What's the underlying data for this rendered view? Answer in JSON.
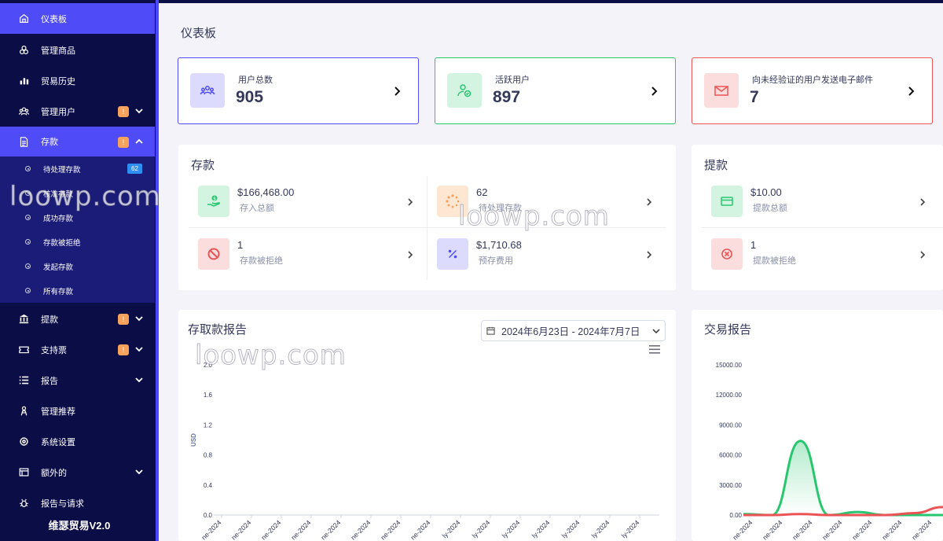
{
  "sidebar": {
    "items": [
      {
        "label": "仪表板",
        "icon": "home-icon",
        "active": true
      },
      {
        "label": "管理商品",
        "icon": "products-icon"
      },
      {
        "label": "贸易历史",
        "icon": "chart-icon"
      },
      {
        "label": "管理用户",
        "icon": "users-icon",
        "badge": "!",
        "chevron": "down"
      },
      {
        "label": "存款",
        "icon": "deposit-icon",
        "badge": "!",
        "chevron": "up",
        "active": true
      },
      {
        "label": "提款",
        "icon": "bank-icon",
        "badge": "!",
        "chevron": "down"
      },
      {
        "label": "支持票",
        "icon": "ticket-icon",
        "badge": "!",
        "chevron": "down"
      },
      {
        "label": "报告",
        "icon": "list-icon",
        "chevron": "down"
      },
      {
        "label": "管理推荐",
        "icon": "referral-icon"
      },
      {
        "label": "系统设置",
        "icon": "settings-icon"
      },
      {
        "label": "额外的",
        "icon": "extra-icon",
        "chevron": "down"
      },
      {
        "label": "报告与请求",
        "icon": "bug-icon"
      }
    ],
    "deposit_subitems": [
      {
        "label": "待处理存款",
        "count": "62"
      },
      {
        "label": "核准存款"
      },
      {
        "label": "成功存款"
      },
      {
        "label": "存款被拒绝"
      },
      {
        "label": "发起存款"
      },
      {
        "label": "所有存款"
      }
    ],
    "brand": "维瑟贸易V2.0"
  },
  "page_title": "仪表板",
  "widgets": [
    {
      "label": "用户总数",
      "value": "905",
      "color": "#4f4cf7"
    },
    {
      "label": "活跃用户",
      "value": "897",
      "color": "#28c76f"
    },
    {
      "label": "向未经验证的用户发送电子邮件",
      "value": "7",
      "color": "#ea5455"
    }
  ],
  "deposits": {
    "title": "存款",
    "stats": [
      {
        "value": "$166,468.00",
        "label": "存入总额"
      },
      {
        "value": "62",
        "label": "待处理存款"
      },
      {
        "value": "1",
        "label": "存款被拒绝"
      },
      {
        "value": "$1,710.68",
        "label": "预存费用"
      }
    ]
  },
  "withdrawals": {
    "title": "提款",
    "stats": [
      {
        "value": "$10.00",
        "label": "提款总额"
      },
      {
        "value": "1",
        "label": "提款被拒绝"
      }
    ]
  },
  "deposit_report": {
    "title": "存取款报告",
    "date_range": "2024年6月23日 - 2024年7月7日"
  },
  "transaction_report": {
    "title": "交易报告"
  },
  "watermark": "loowp.com",
  "chart_data": [
    {
      "type": "line",
      "title": "存取款报告",
      "ylabel": "USD",
      "ylim": [
        0,
        2.0
      ],
      "y_ticks": [
        "0.0",
        "0.4",
        "0.8",
        "1.2",
        "1.6",
        "2.0"
      ],
      "x": [
        "ne-2024",
        "ne-2024",
        "ne-2024",
        "ne-2024",
        "ne-2024",
        "ne-2024",
        "ne-2024",
        "ne-2024",
        "ly-2024",
        "ly-2024",
        "ly-2024",
        "ly-2024",
        "ly-2024",
        "ly-2024",
        "ly-2024"
      ],
      "series": []
    },
    {
      "type": "line",
      "title": "交易报告",
      "ylim": [
        0,
        15000
      ],
      "y_ticks": [
        "0.00",
        "3000.00",
        "6000.00",
        "9000.00",
        "12000.00",
        "15000.00"
      ],
      "x": [
        "ne-2024",
        "ne-2024",
        "ne-2024",
        "ne-2024",
        "ne-2024",
        "ne-2024",
        "ne-2024"
      ],
      "series": [
        {
          "color": "#28c76f",
          "values": [
            100,
            0,
            7400,
            0,
            300,
            0,
            0,
            0
          ]
        },
        {
          "color": "#ea5455",
          "values": [
            0,
            0,
            100,
            0,
            0,
            0,
            200,
            800
          ]
        }
      ]
    }
  ]
}
